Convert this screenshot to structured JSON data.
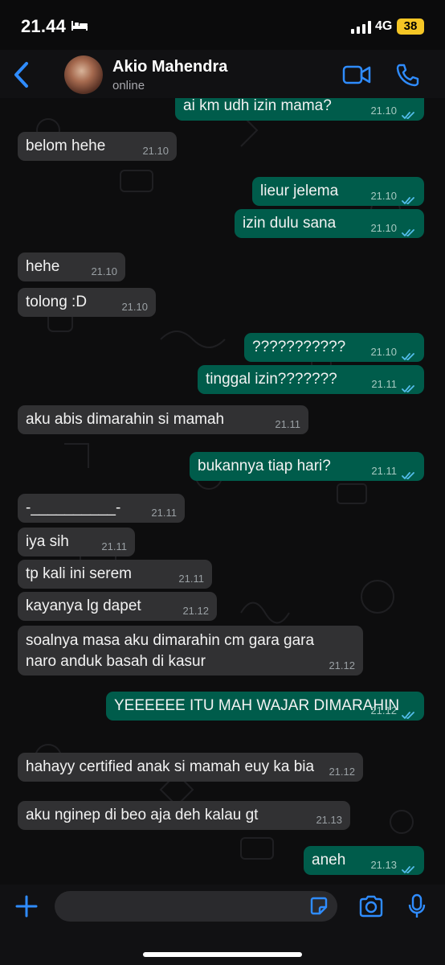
{
  "status_bar": {
    "time": "21.44",
    "network": "4G",
    "battery": "38"
  },
  "header": {
    "contact_name": "Akio Mahendra",
    "presence": "online"
  },
  "messages": [
    {
      "dir": "out",
      "text": "ai km udh izin mama?",
      "time": "21.10"
    },
    {
      "dir": "in",
      "text": "belom hehe",
      "time": "21.10"
    },
    {
      "dir": "out",
      "text": "lieur jelema",
      "time": "21.10"
    },
    {
      "dir": "out",
      "text": "izin dulu sana",
      "time": "21.10"
    },
    {
      "dir": "in",
      "text": "hehe",
      "time": "21.10"
    },
    {
      "dir": "in",
      "text": "tolong :D",
      "time": "21.10"
    },
    {
      "dir": "out",
      "text": "???????????",
      "time": "21.10"
    },
    {
      "dir": "out",
      "text": "tinggal izin???????",
      "time": "21.11"
    },
    {
      "dir": "in",
      "text": "aku abis dimarahin si mamah",
      "time": "21.11"
    },
    {
      "dir": "out",
      "text": "bukannya tiap hari?",
      "time": "21.11"
    },
    {
      "dir": "in",
      "text": "-__________-",
      "time": "21.11"
    },
    {
      "dir": "in",
      "text": "iya sih",
      "time": "21.11"
    },
    {
      "dir": "in",
      "text": "tp kali ini serem",
      "time": "21.11"
    },
    {
      "dir": "in",
      "text": "kayanya lg dapet",
      "time": "21.12"
    },
    {
      "dir": "in",
      "line1": "soalnya masa aku dimarahin cm gara gara",
      "line2": "naro anduk basah di kasur",
      "time": "21.12"
    },
    {
      "dir": "out",
      "text": "YEEEEEE ITU MAH WAJAR DIMARAHIN",
      "time": "21.12"
    },
    {
      "dir": "in",
      "text": "hahayy certified anak si mamah euy ka bia",
      "time": "21.12"
    },
    {
      "dir": "in",
      "text": "aku nginep di beo aja deh kalau gt",
      "time": "21.13"
    },
    {
      "dir": "out",
      "text": "aneh",
      "time": "21.13"
    }
  ],
  "composer": {
    "placeholder": ""
  },
  "colors": {
    "incoming": "#313133",
    "outgoing": "#005c4b",
    "accent": "#1e90ff",
    "read_tick": "#53bdeb"
  }
}
